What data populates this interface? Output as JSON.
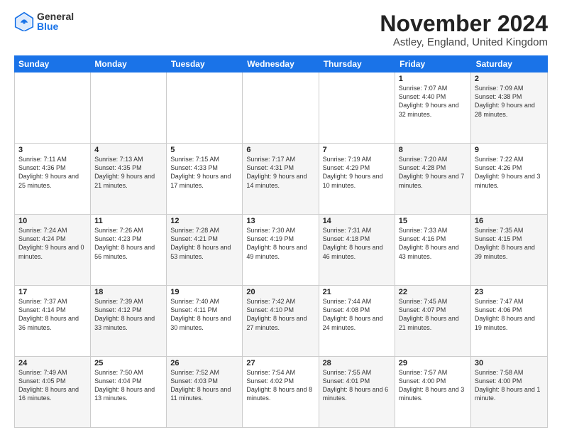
{
  "logo": {
    "general": "General",
    "blue": "Blue"
  },
  "title": "November 2024",
  "location": "Astley, England, United Kingdom",
  "weekdays": [
    "Sunday",
    "Monday",
    "Tuesday",
    "Wednesday",
    "Thursday",
    "Friday",
    "Saturday"
  ],
  "rows": [
    [
      {
        "day": "",
        "info": "",
        "shaded": false,
        "empty": true
      },
      {
        "day": "",
        "info": "",
        "shaded": false,
        "empty": true
      },
      {
        "day": "",
        "info": "",
        "shaded": false,
        "empty": true
      },
      {
        "day": "",
        "info": "",
        "shaded": false,
        "empty": true
      },
      {
        "day": "",
        "info": "",
        "shaded": false,
        "empty": true
      },
      {
        "day": "1",
        "info": "Sunrise: 7:07 AM\nSunset: 4:40 PM\nDaylight: 9 hours and 32 minutes.",
        "shaded": false,
        "empty": false
      },
      {
        "day": "2",
        "info": "Sunrise: 7:09 AM\nSunset: 4:38 PM\nDaylight: 9 hours and 28 minutes.",
        "shaded": true,
        "empty": false
      }
    ],
    [
      {
        "day": "3",
        "info": "Sunrise: 7:11 AM\nSunset: 4:36 PM\nDaylight: 9 hours and 25 minutes.",
        "shaded": false,
        "empty": false
      },
      {
        "day": "4",
        "info": "Sunrise: 7:13 AM\nSunset: 4:35 PM\nDaylight: 9 hours and 21 minutes.",
        "shaded": true,
        "empty": false
      },
      {
        "day": "5",
        "info": "Sunrise: 7:15 AM\nSunset: 4:33 PM\nDaylight: 9 hours and 17 minutes.",
        "shaded": false,
        "empty": false
      },
      {
        "day": "6",
        "info": "Sunrise: 7:17 AM\nSunset: 4:31 PM\nDaylight: 9 hours and 14 minutes.",
        "shaded": true,
        "empty": false
      },
      {
        "day": "7",
        "info": "Sunrise: 7:19 AM\nSunset: 4:29 PM\nDaylight: 9 hours and 10 minutes.",
        "shaded": false,
        "empty": false
      },
      {
        "day": "8",
        "info": "Sunrise: 7:20 AM\nSunset: 4:28 PM\nDaylight: 9 hours and 7 minutes.",
        "shaded": true,
        "empty": false
      },
      {
        "day": "9",
        "info": "Sunrise: 7:22 AM\nSunset: 4:26 PM\nDaylight: 9 hours and 3 minutes.",
        "shaded": false,
        "empty": false
      }
    ],
    [
      {
        "day": "10",
        "info": "Sunrise: 7:24 AM\nSunset: 4:24 PM\nDaylight: 9 hours and 0 minutes.",
        "shaded": true,
        "empty": false
      },
      {
        "day": "11",
        "info": "Sunrise: 7:26 AM\nSunset: 4:23 PM\nDaylight: 8 hours and 56 minutes.",
        "shaded": false,
        "empty": false
      },
      {
        "day": "12",
        "info": "Sunrise: 7:28 AM\nSunset: 4:21 PM\nDaylight: 8 hours and 53 minutes.",
        "shaded": true,
        "empty": false
      },
      {
        "day": "13",
        "info": "Sunrise: 7:30 AM\nSunset: 4:19 PM\nDaylight: 8 hours and 49 minutes.",
        "shaded": false,
        "empty": false
      },
      {
        "day": "14",
        "info": "Sunrise: 7:31 AM\nSunset: 4:18 PM\nDaylight: 8 hours and 46 minutes.",
        "shaded": true,
        "empty": false
      },
      {
        "day": "15",
        "info": "Sunrise: 7:33 AM\nSunset: 4:16 PM\nDaylight: 8 hours and 43 minutes.",
        "shaded": false,
        "empty": false
      },
      {
        "day": "16",
        "info": "Sunrise: 7:35 AM\nSunset: 4:15 PM\nDaylight: 8 hours and 39 minutes.",
        "shaded": true,
        "empty": false
      }
    ],
    [
      {
        "day": "17",
        "info": "Sunrise: 7:37 AM\nSunset: 4:14 PM\nDaylight: 8 hours and 36 minutes.",
        "shaded": false,
        "empty": false
      },
      {
        "day": "18",
        "info": "Sunrise: 7:39 AM\nSunset: 4:12 PM\nDaylight: 8 hours and 33 minutes.",
        "shaded": true,
        "empty": false
      },
      {
        "day": "19",
        "info": "Sunrise: 7:40 AM\nSunset: 4:11 PM\nDaylight: 8 hours and 30 minutes.",
        "shaded": false,
        "empty": false
      },
      {
        "day": "20",
        "info": "Sunrise: 7:42 AM\nSunset: 4:10 PM\nDaylight: 8 hours and 27 minutes.",
        "shaded": true,
        "empty": false
      },
      {
        "day": "21",
        "info": "Sunrise: 7:44 AM\nSunset: 4:08 PM\nDaylight: 8 hours and 24 minutes.",
        "shaded": false,
        "empty": false
      },
      {
        "day": "22",
        "info": "Sunrise: 7:45 AM\nSunset: 4:07 PM\nDaylight: 8 hours and 21 minutes.",
        "shaded": true,
        "empty": false
      },
      {
        "day": "23",
        "info": "Sunrise: 7:47 AM\nSunset: 4:06 PM\nDaylight: 8 hours and 19 minutes.",
        "shaded": false,
        "empty": false
      }
    ],
    [
      {
        "day": "24",
        "info": "Sunrise: 7:49 AM\nSunset: 4:05 PM\nDaylight: 8 hours and 16 minutes.",
        "shaded": true,
        "empty": false
      },
      {
        "day": "25",
        "info": "Sunrise: 7:50 AM\nSunset: 4:04 PM\nDaylight: 8 hours and 13 minutes.",
        "shaded": false,
        "empty": false
      },
      {
        "day": "26",
        "info": "Sunrise: 7:52 AM\nSunset: 4:03 PM\nDaylight: 8 hours and 11 minutes.",
        "shaded": true,
        "empty": false
      },
      {
        "day": "27",
        "info": "Sunrise: 7:54 AM\nSunset: 4:02 PM\nDaylight: 8 hours and 8 minutes.",
        "shaded": false,
        "empty": false
      },
      {
        "day": "28",
        "info": "Sunrise: 7:55 AM\nSunset: 4:01 PM\nDaylight: 8 hours and 6 minutes.",
        "shaded": true,
        "empty": false
      },
      {
        "day": "29",
        "info": "Sunrise: 7:57 AM\nSunset: 4:00 PM\nDaylight: 8 hours and 3 minutes.",
        "shaded": false,
        "empty": false
      },
      {
        "day": "30",
        "info": "Sunrise: 7:58 AM\nSunset: 4:00 PM\nDaylight: 8 hours and 1 minute.",
        "shaded": true,
        "empty": false
      }
    ]
  ]
}
